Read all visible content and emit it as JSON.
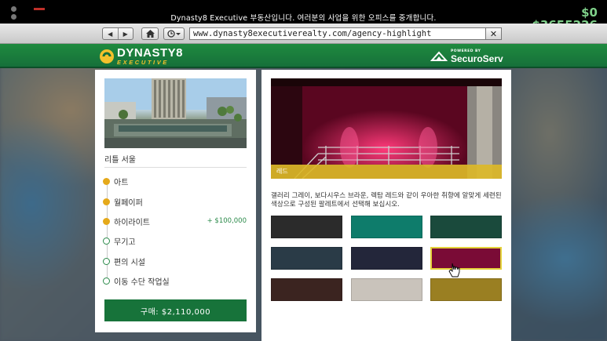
{
  "browser": {
    "page_title": "Dynasty8 Executive 부동산입니다. 여러분의 사업을 위한 오피스를 중개합니다.",
    "url": "www.dynasty8executiverealty.com/agency-highlight",
    "back_icon": "back-arrow-icon",
    "forward_icon": "forward-arrow-icon",
    "home_icon": "home-icon",
    "history_icon": "history-clock-icon",
    "close_icon": "close-x-icon"
  },
  "hud": {
    "cash": "$0",
    "bank": "$3655226",
    "money_color": "#7fd18a"
  },
  "header": {
    "brand_line1": "DYNASTY8",
    "brand_line2": "EXECUTIVE",
    "powered_by": "POWERED BY",
    "partner": "SecuroServ",
    "brand_color": "#1b7f3d",
    "accent_color": "#f4c12c"
  },
  "office": {
    "location_name": "리틀 서울",
    "steps": [
      {
        "label": "아트",
        "done": true,
        "price": ""
      },
      {
        "label": "월페이퍼",
        "done": true,
        "price": ""
      },
      {
        "label": "하이라이트",
        "done": true,
        "price": "+ $100,000"
      },
      {
        "label": "무기고",
        "done": false,
        "price": ""
      },
      {
        "label": "편의 시설",
        "done": false,
        "price": ""
      },
      {
        "label": "이동 수단 작업실",
        "done": false,
        "price": ""
      }
    ],
    "buy_label": "구매: $2,110,000"
  },
  "highlight": {
    "preview_caption": "레드",
    "description": "갤러리 그레이, 보다시우스 브라운, 렉탐 레드와 같이 우아한 취향에 알맞게 세련된 색상으로 구성된 팔레트에서 선택해 보십시오.",
    "selected_index": 5,
    "swatches": [
      "#2b2b2b",
      "#0e7c6b",
      "#1a4a3c",
      "#2a3b47",
      "#23263a",
      "#7a0b36",
      "#3b2420",
      "#c9c3bb",
      "#9a7f22"
    ]
  }
}
